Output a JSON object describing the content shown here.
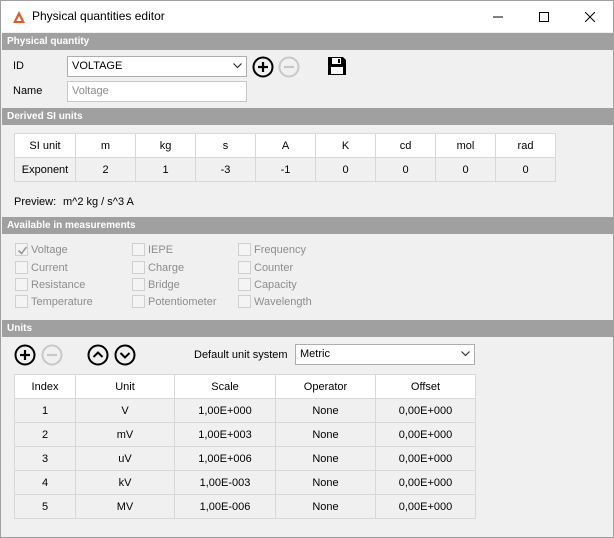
{
  "window": {
    "title": "Physical quantities editor"
  },
  "sections": {
    "physical_quantity": "Physical quantity",
    "derived_si": "Derived SI units",
    "available": "Available in measurements",
    "units": "Units"
  },
  "quantity": {
    "id_label": "ID",
    "id_value": "VOLTAGE",
    "name_label": "Name",
    "name_placeholder": "Voltage"
  },
  "si_table": {
    "row_header": "SI unit",
    "row_values_header": "Exponent",
    "columns": [
      "m",
      "kg",
      "s",
      "A",
      "K",
      "cd",
      "mol",
      "rad"
    ],
    "exponents": [
      "2",
      "1",
      "-3",
      "-1",
      "0",
      "0",
      "0",
      "0"
    ]
  },
  "preview": {
    "label": "Preview:",
    "value": "m^2 kg / s^3 A"
  },
  "measurements": [
    {
      "label": "Voltage",
      "checked": true
    },
    {
      "label": "Current",
      "checked": false
    },
    {
      "label": "Resistance",
      "checked": false
    },
    {
      "label": "Temperature",
      "checked": false
    },
    {
      "label": "IEPE",
      "checked": false
    },
    {
      "label": "Charge",
      "checked": false
    },
    {
      "label": "Bridge",
      "checked": false
    },
    {
      "label": "Potentiometer",
      "checked": false
    },
    {
      "label": "Frequency",
      "checked": false
    },
    {
      "label": "Counter",
      "checked": false
    },
    {
      "label": "Capacity",
      "checked": false
    },
    {
      "label": "Wavelength",
      "checked": false
    }
  ],
  "units": {
    "default_label": "Default unit system",
    "default_value": "Metric",
    "headers": [
      "Index",
      "Unit",
      "Scale",
      "Operator",
      "Offset"
    ],
    "rows": [
      [
        "1",
        "V",
        "1,00E+000",
        "None",
        "0,00E+000"
      ],
      [
        "2",
        "mV",
        "1,00E+003",
        "None",
        "0,00E+000"
      ],
      [
        "3",
        "uV",
        "1,00E+006",
        "None",
        "0,00E+000"
      ],
      [
        "4",
        "kV",
        "1,00E-003",
        "None",
        "0,00E+000"
      ],
      [
        "5",
        "MV",
        "1,00E-006",
        "None",
        "0,00E+000"
      ]
    ]
  },
  "colors": {
    "accent": "#e05a2a",
    "section": "#a0a0a0",
    "disabled": "#8d8d8d"
  }
}
